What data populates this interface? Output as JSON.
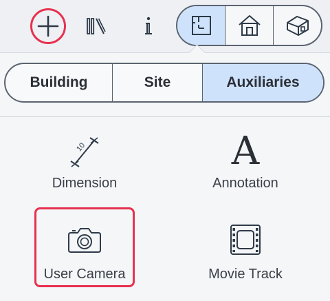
{
  "toolbar": {
    "icons": [
      "add-icon",
      "library-icon",
      "info-icon"
    ],
    "view_modes": [
      {
        "id": "floorplan",
        "icon": "floorplan-icon",
        "active": true
      },
      {
        "id": "elevation",
        "icon": "house-icon",
        "active": false
      },
      {
        "id": "3d",
        "icon": "3d-house-icon",
        "active": false
      }
    ],
    "accent_color": "#e8304e",
    "active_color": "#cfe2fb"
  },
  "tabs": {
    "items": [
      {
        "label": "Building",
        "active": false
      },
      {
        "label": "Site",
        "active": false
      },
      {
        "label": "Auxiliaries",
        "active": true
      }
    ]
  },
  "tools": {
    "dimension": {
      "label": "Dimension",
      "icon": "dimension-icon",
      "value_text": "10"
    },
    "annotation": {
      "label": "Annotation",
      "icon": "annotation-icon",
      "glyph": "A"
    },
    "camera": {
      "label": "User Camera",
      "icon": "camera-icon",
      "selected": true
    },
    "movie": {
      "label": "Movie Track",
      "icon": "film-strip-icon"
    }
  }
}
